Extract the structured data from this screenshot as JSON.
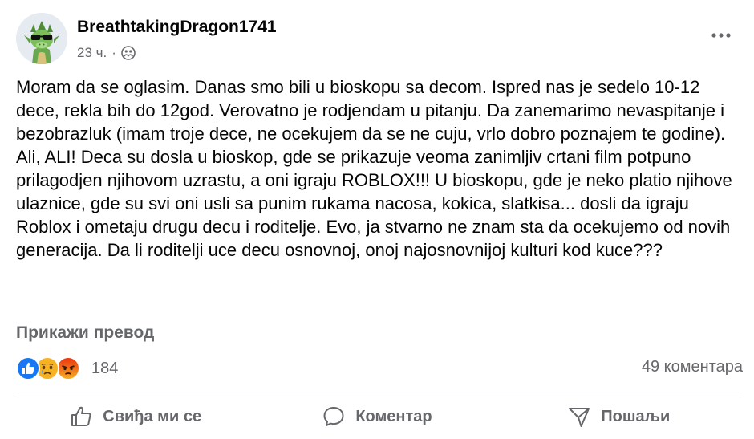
{
  "post": {
    "author": "BreathtakingDragon1741",
    "time": "23 ч.",
    "separator": "·",
    "audience_icon": "friends-icon",
    "text": "Moram da se oglasim. Danas smo bili u bioskopu sa decom. Ispred nas je sedelo 10-12 dece, rekla bih do 12god. Verovatno je rodjendam u pitanju. Da zanemarimo nevaspitanje i bezobrazluk (imam troje dece, ne ocekujem da se ne cuju, vrlo dobro poznajem te godine). Ali, ALI! Deca su dosla u bioskop, gde se prikazuje veoma zanimljiv crtani film potpuno prilagodjen njihovom uzrastu, a oni igraju ROBLOX!!! U bioskopu, gde je neko platio njihove ulaznice, gde su svi oni  usli sa punim rukama nacosa, kokica, slatkisa... dosli da igraju Roblox i ometaju drugu decu i roditelje. Evo, ja stvarno ne znam sta da ocekujemo od novih generacija. Da li roditelji uce decu osnovnoj, onoj najosnovnijoj kulturi kod kuce???",
    "translate_label": "Прикажи превод"
  },
  "reactions": {
    "icons": [
      "like-reaction-icon",
      "sad-reaction-icon",
      "angry-reaction-icon"
    ],
    "count": "184",
    "comments": "49 коментара"
  },
  "actions": {
    "like": "Свиђа ми се",
    "comment": "Коментар",
    "share": "Пошаљи"
  },
  "colors": {
    "like_blue": "#1877f2",
    "text_secondary": "#65676b",
    "sad_yellow": "#f7b125",
    "angry_orange": "#e9710f"
  }
}
